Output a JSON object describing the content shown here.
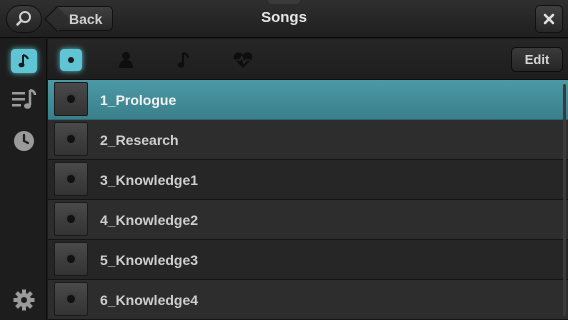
{
  "header": {
    "title": "Songs",
    "back_label": "Back"
  },
  "icons": {
    "search": "search-icon",
    "close": "close-icon"
  },
  "sidebar": {
    "items": [
      {
        "name": "songs",
        "icon": "music-note-icon",
        "active": true
      },
      {
        "name": "playlists",
        "icon": "playlist-icon",
        "active": false
      },
      {
        "name": "recent",
        "icon": "clock-icon",
        "active": false
      },
      {
        "name": "settings",
        "icon": "gear-icon",
        "active": false
      }
    ]
  },
  "filters": {
    "items": [
      {
        "name": "all",
        "icon": "record-icon",
        "active": true
      },
      {
        "name": "artists",
        "icon": "person-icon",
        "active": false
      },
      {
        "name": "tracks",
        "icon": "music-note-icon",
        "active": false
      },
      {
        "name": "favorites",
        "icon": "heart-icon",
        "active": false
      }
    ],
    "edit_label": "Edit"
  },
  "songs": [
    {
      "title": "1_Prologue",
      "selected": true
    },
    {
      "title": "2_Research",
      "selected": false
    },
    {
      "title": "3_Knowledge1",
      "selected": false
    },
    {
      "title": "4_Knowledge2",
      "selected": false
    },
    {
      "title": "5_Knowledge3",
      "selected": false
    },
    {
      "title": "6_Knowledge4",
      "selected": false
    }
  ],
  "colors": {
    "accent": "#5fc4d4",
    "selected_row": "#4592a0",
    "background": "#1b1b1b"
  }
}
